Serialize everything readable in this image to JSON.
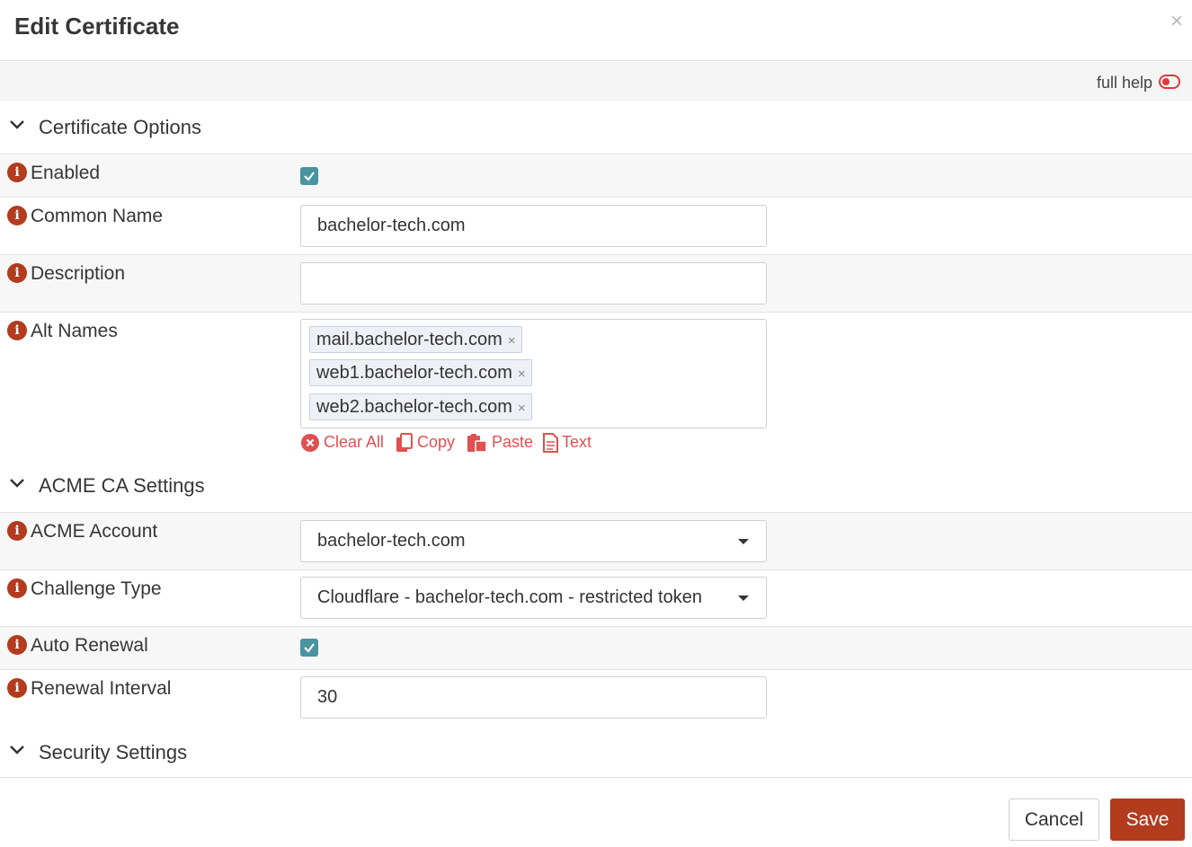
{
  "dialog": {
    "title": "Edit Certificate",
    "close_glyph": "×"
  },
  "help": {
    "label": "full help"
  },
  "sections": {
    "certificate_options": "Certificate Options",
    "acme_ca_settings": "ACME CA Settings",
    "security_settings": "Security Settings"
  },
  "fields": {
    "enabled": {
      "label": "Enabled",
      "checked": true
    },
    "common_name": {
      "label": "Common Name",
      "value": "bachelor-tech.com"
    },
    "description": {
      "label": "Description",
      "value": ""
    },
    "alt_names": {
      "label": "Alt Names",
      "tags": [
        "mail.bachelor-tech.com",
        "web1.bachelor-tech.com",
        "web2.bachelor-tech.com"
      ],
      "tag_remove_glyph": "×",
      "actions": {
        "clear_all": "Clear All",
        "copy": "Copy",
        "paste": "Paste",
        "text": "Text"
      }
    },
    "acme_account": {
      "label": "ACME Account",
      "value": "bachelor-tech.com"
    },
    "challenge_type": {
      "label": "Challenge Type",
      "value": "Cloudflare - bachelor-tech.com - restricted token"
    },
    "auto_renewal": {
      "label": "Auto Renewal",
      "checked": true
    },
    "renewal_interval": {
      "label": "Renewal Interval",
      "value": "30"
    }
  },
  "info_glyph": "i",
  "buttons": {
    "cancel": "Cancel",
    "save": "Save"
  },
  "colors": {
    "accent": "#b33b1e",
    "checkbox": "#4a93a0",
    "link_red": "#e05050",
    "toggle": "#e0383e"
  },
  "icons": {
    "chevron": "chevron-down-icon",
    "info": "info-icon",
    "close": "close-icon",
    "toggle": "toggle-icon",
    "clear": "clear-circle-icon",
    "copy": "copy-icon",
    "paste": "paste-icon",
    "text": "text-file-icon"
  }
}
